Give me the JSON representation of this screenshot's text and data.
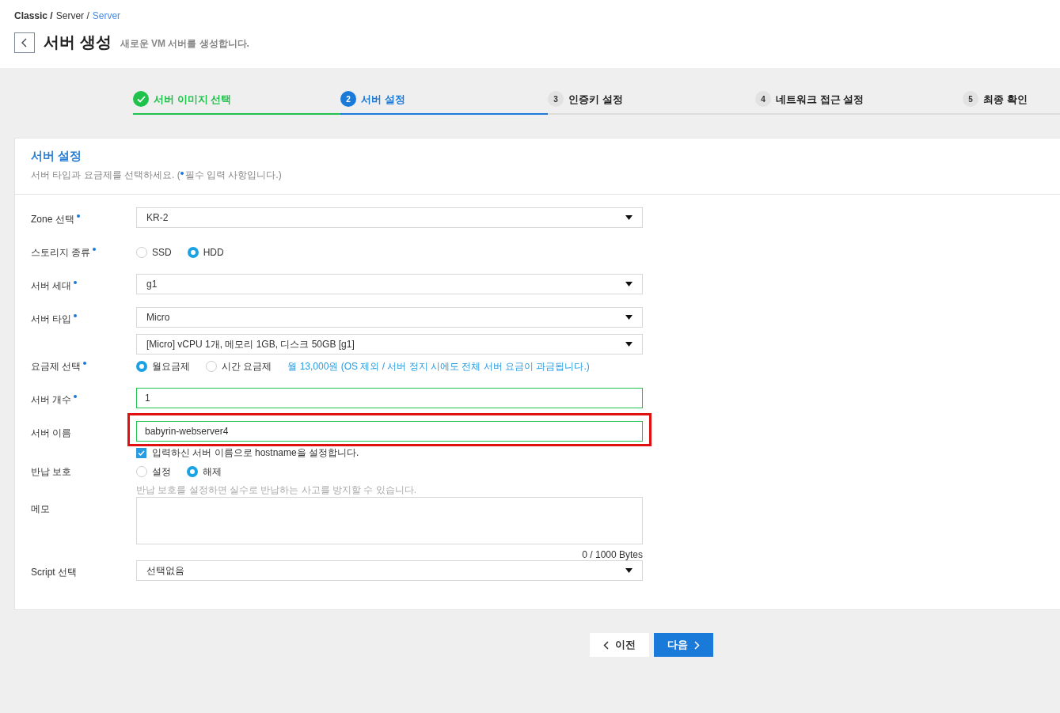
{
  "breadcrumb": [
    {
      "label": "Classic /",
      "current": false
    },
    {
      "label": "Server /",
      "current": false
    },
    {
      "label": "Server",
      "current": true
    }
  ],
  "header": {
    "title": "서버 생성",
    "subtitle": "새로운 VM 서버를 생성합니다."
  },
  "steps": [
    {
      "label": "서버 이미지 선택",
      "done": true,
      "selected": false
    },
    {
      "number": "2",
      "label": "서버 설정",
      "done": false,
      "selected": true
    },
    {
      "number": "3",
      "label": "인증키 설정",
      "done": false,
      "selected": false
    },
    {
      "number": "4",
      "label": "네트워크 접근 설정",
      "done": false,
      "selected": false
    },
    {
      "number": "5",
      "label": "최종 확인",
      "done": false,
      "selected": false
    }
  ],
  "section": {
    "title": "서버 설정",
    "description": "서버 타입과 요금제를 선택하세요. (",
    "required_note": "필수 입력 사항입니다.)"
  },
  "rows": [
    {
      "label": "Zone 선택",
      "required": true,
      "kind": "select",
      "values": [
        "KR-2"
      ]
    },
    {
      "label": "스토리지 종류",
      "required": true,
      "kind": "radio",
      "options": [
        {
          "label": "SSD",
          "selected": false
        },
        {
          "label": "HDD",
          "selected": true
        }
      ]
    },
    {
      "label": "서버 세대",
      "required": true,
      "kind": "select",
      "values": [
        "g1"
      ]
    },
    {
      "label": "서버 타입",
      "required": true,
      "kind": "select",
      "values": [
        "Micro",
        "[Micro] vCPU 1개, 메모리 1GB, 디스크 50GB [g1]"
      ]
    },
    {
      "label": "요금제 선택",
      "required": true,
      "kind": "radio",
      "options": [
        {
          "label": "월요금제",
          "selected": true
        },
        {
          "label": "시간 요금제",
          "selected": false
        }
      ],
      "note": "월 13,000원 (OS 제외 / 서버 정지 시에도 전체 서버 요금이 과금됩니다.)"
    },
    {
      "label": "서버 개수",
      "required": true,
      "kind": "input",
      "value": "1",
      "highlighted": false
    },
    {
      "label": "서버 이름",
      "required": false,
      "kind": "input",
      "value": "babyrin-webserver4",
      "highlighted": true,
      "checkbox": {
        "label": "입력하신 서버 이름으로 hostname을 설정합니다.",
        "checked": true
      }
    },
    {
      "label": "반납 보호",
      "required": false,
      "kind": "radio",
      "options": [
        {
          "label": "설정",
          "selected": false
        },
        {
          "label": "해제",
          "selected": true
        }
      ],
      "help": "반납 보호를 설정하면 실수로 반납하는 사고를 방지할 수 있습니다."
    },
    {
      "label": "메모",
      "required": false,
      "kind": "textarea",
      "counter": "0 / 1000 Bytes"
    },
    {
      "label": "Script 선택",
      "required": false,
      "kind": "select",
      "values": [
        "선택없음"
      ]
    }
  ],
  "buttons": {
    "prev": "이전",
    "next": "다음"
  }
}
